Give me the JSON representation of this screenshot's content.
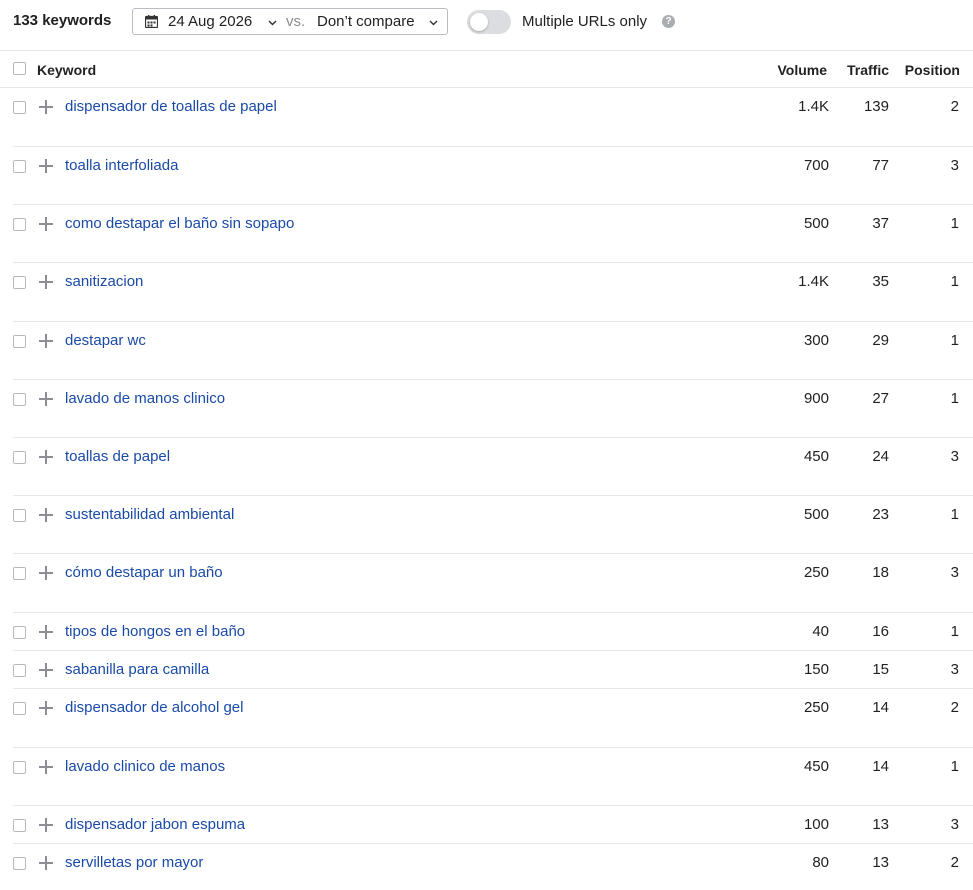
{
  "toolbar": {
    "keywords_count": "133 keywords",
    "date": "24 Aug 2026",
    "vs_label": "vs.",
    "compare_label": "Don’t compare",
    "multiple_urls_label": "Multiple URLs only",
    "multiple_urls_enabled": false
  },
  "table": {
    "columns": {
      "keyword": "Keyword",
      "volume": "Volume",
      "traffic": "Traffic",
      "position": "Position"
    },
    "rows": [
      {
        "keyword": "dispensador de toallas de papel",
        "volume": "1.4K",
        "traffic": "139",
        "position": "2"
      },
      {
        "keyword": "toalla interfoliada",
        "volume": "700",
        "traffic": "77",
        "position": "3"
      },
      {
        "keyword": "como destapar el baño sin sopapo",
        "volume": "500",
        "traffic": "37",
        "position": "1"
      },
      {
        "keyword": "sanitizacion",
        "volume": "1.4K",
        "traffic": "35",
        "position": "1"
      },
      {
        "keyword": "destapar wc",
        "volume": "300",
        "traffic": "29",
        "position": "1"
      },
      {
        "keyword": "lavado de manos clinico",
        "volume": "900",
        "traffic": "27",
        "position": "1"
      },
      {
        "keyword": "toallas de papel",
        "volume": "450",
        "traffic": "24",
        "position": "3"
      },
      {
        "keyword": "sustentabilidad ambiental",
        "volume": "500",
        "traffic": "23",
        "position": "1"
      },
      {
        "keyword": "cómo destapar un baño",
        "volume": "250",
        "traffic": "18",
        "position": "3"
      },
      {
        "keyword": "tipos de hongos en el baño",
        "volume": "40",
        "traffic": "16",
        "position": "1"
      },
      {
        "keyword": "sabanilla para camilla",
        "volume": "150",
        "traffic": "15",
        "position": "3"
      },
      {
        "keyword": "dispensador de alcohol gel",
        "volume": "250",
        "traffic": "14",
        "position": "2"
      },
      {
        "keyword": "lavado clinico de manos",
        "volume": "450",
        "traffic": "14",
        "position": "1"
      },
      {
        "keyword": "dispensador jabon espuma",
        "volume": "100",
        "traffic": "13",
        "position": "3"
      },
      {
        "keyword": "servilletas por mayor",
        "volume": "80",
        "traffic": "13",
        "position": "2"
      }
    ]
  }
}
